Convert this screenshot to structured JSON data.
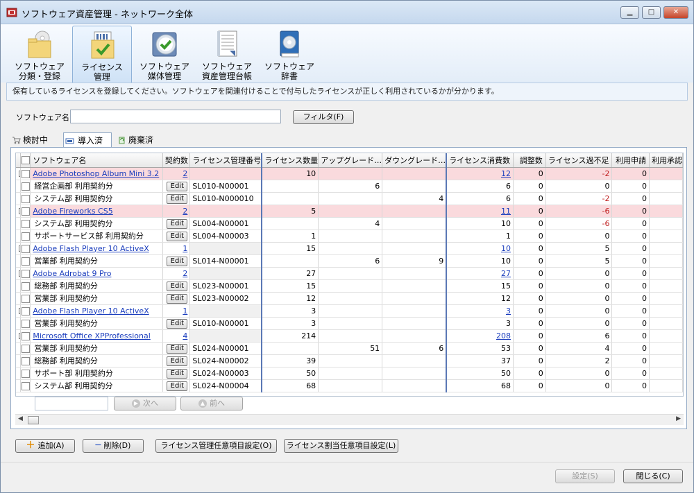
{
  "window": {
    "title": "ソフトウェア資産管理 - ネットワーク全体",
    "controls": {
      "minimize": "▁",
      "maximize": "□",
      "close": "✕"
    }
  },
  "ribbon": [
    {
      "line1": "ソフトウェア",
      "line2": "分類・登録",
      "icon": "folder-disc-icon"
    },
    {
      "line1": "ライセンス",
      "line2": "管理",
      "icon": "license-check-icon"
    },
    {
      "line1": "ソフトウェア",
      "line2": "媒体管理",
      "icon": "media-check-icon"
    },
    {
      "line1": "ソフトウェア",
      "line2": "資産管理台帳",
      "icon": "ledger-icon"
    },
    {
      "line1": "ソフトウェア",
      "line2": "辞書",
      "icon": "dictionary-icon"
    }
  ],
  "info_text": "保有しているライセンスを登録してください。ソフトウェアを関連付けることで付与したライセンスが正しく利用されているかが分かります。",
  "filter": {
    "label": "ソフトウェア名",
    "value": "",
    "button": "フィルタ(F)"
  },
  "tabs": [
    "検討中",
    "導入済",
    "廃棄済"
  ],
  "columns": [
    "ソフトウェア名",
    "契約数",
    "ライセンス管理番号",
    "ライセンス数量",
    "アップグレード…",
    "ダウングレード…",
    "ライセンス消費数",
    "調整数",
    "ライセンス過不足",
    "利用申請",
    "利用承認"
  ],
  "rows": [
    {
      "level": 0,
      "name": "Adobe  Photoshop Album Mini 3.2",
      "contracts": "2",
      "license_no": "",
      "qty": "10",
      "up": "",
      "down": "",
      "consumed": "12",
      "adjust": "0",
      "diff": "-2",
      "req": "0",
      "pink": true
    },
    {
      "level": 1,
      "name": "経営企画部  利用契約分",
      "contracts": "Edit",
      "license_no": "SL010-N00001",
      "qty": "",
      "up": "6",
      "down": "",
      "consumed": "6",
      "adjust": "0",
      "diff": "0",
      "req": "0",
      "pink": false
    },
    {
      "level": 1,
      "name": "システム部  利用契約分",
      "contracts": "Edit",
      "license_no": "SL010-N000010",
      "qty": "",
      "up": "",
      "down": "4",
      "consumed": "6",
      "adjust": "0",
      "diff": "-2",
      "req": "0",
      "pink": false
    },
    {
      "level": 0,
      "name": "Adobe Fireworks CS5",
      "contracts": "2",
      "license_no": "",
      "qty": "5",
      "up": "",
      "down": "",
      "consumed": "11",
      "adjust": "0",
      "diff": "-6",
      "req": "0",
      "pink": true
    },
    {
      "level": 1,
      "name": "システム部  利用契約分",
      "contracts": "Edit",
      "license_no": "SL004-N00001",
      "qty": "",
      "up": "4",
      "down": "",
      "consumed": "10",
      "adjust": "0",
      "diff": "-6",
      "req": "0",
      "pink": false
    },
    {
      "level": 1,
      "name": "サポートサービス部  利用契約分",
      "contracts": "Edit",
      "license_no": "SL004-N00003",
      "qty": "1",
      "up": "",
      "down": "",
      "consumed": "1",
      "adjust": "0",
      "diff": "0",
      "req": "0",
      "pink": false
    },
    {
      "level": 0,
      "name": "Adobe Flash Player 10 ActiveX",
      "contracts": "1",
      "license_no": "",
      "qty": "15",
      "up": "",
      "down": "",
      "consumed": "10",
      "adjust": "0",
      "diff": "5",
      "req": "0",
      "pink": false
    },
    {
      "level": 1,
      "name": "営業部  利用契約分",
      "contracts": "Edit",
      "license_no": "SL014-N00001",
      "qty": "",
      "up": "6",
      "down": "9",
      "consumed": "10",
      "adjust": "0",
      "diff": "5",
      "req": "0",
      "pink": false
    },
    {
      "level": 0,
      "name": "Adobe  Adrobat 9 Pro",
      "contracts": "2",
      "license_no": "",
      "qty": "27",
      "up": "",
      "down": "",
      "consumed": "27",
      "adjust": "0",
      "diff": "0",
      "req": "0",
      "pink": false
    },
    {
      "level": 1,
      "name": "総務部  利用契約分",
      "contracts": "Edit",
      "license_no": "SL023-N00001",
      "qty": "15",
      "up": "",
      "down": "",
      "consumed": "15",
      "adjust": "0",
      "diff": "0",
      "req": "0",
      "pink": false
    },
    {
      "level": 1,
      "name": "営業部  利用契約分",
      "contracts": "Edit",
      "license_no": "SL023-N00002",
      "qty": "12",
      "up": "",
      "down": "",
      "consumed": "12",
      "adjust": "0",
      "diff": "0",
      "req": "0",
      "pink": false
    },
    {
      "level": 0,
      "name": "Adobe Flash Player 10 ActiveX",
      "contracts": "1",
      "license_no": "",
      "qty": "3",
      "up": "",
      "down": "",
      "consumed": "3",
      "adjust": "0",
      "diff": "0",
      "req": "0",
      "pink": false
    },
    {
      "level": 1,
      "name": "営業部  利用契約分",
      "contracts": "Edit",
      "license_no": "SL010-N00001",
      "qty": "3",
      "up": "",
      "down": "",
      "consumed": "3",
      "adjust": "0",
      "diff": "0",
      "req": "0",
      "pink": false
    },
    {
      "level": 0,
      "name": "Microsoft Office XPProfessional",
      "contracts": "4",
      "license_no": "",
      "qty": "214",
      "up": "",
      "down": "",
      "consumed": "208",
      "adjust": "0",
      "diff": "6",
      "req": "0",
      "pink": false
    },
    {
      "level": 1,
      "name": "営業部  利用契約分",
      "contracts": "Edit",
      "license_no": "SL024-N00001",
      "qty": "",
      "up": "51",
      "down": "6",
      "consumed": "53",
      "adjust": "0",
      "diff": "4",
      "req": "0",
      "pink": false
    },
    {
      "level": 1,
      "name": "総務部  利用契約分",
      "contracts": "Edit",
      "license_no": "SL024-N00002",
      "qty": "39",
      "up": "",
      "down": "",
      "consumed": "37",
      "adjust": "0",
      "diff": "2",
      "req": "0",
      "pink": false
    },
    {
      "level": 1,
      "name": "サポート部  利用契約分",
      "contracts": "Edit",
      "license_no": "SL024-N00003",
      "qty": "50",
      "up": "",
      "down": "",
      "consumed": "50",
      "adjust": "0",
      "diff": "0",
      "req": "0",
      "pink": false
    },
    {
      "level": 1,
      "name": "システム部  利用契約分",
      "contracts": "Edit",
      "license_no": "SL024-N00004",
      "qty": "68",
      "up": "",
      "down": "",
      "consumed": "68",
      "adjust": "0",
      "diff": "0",
      "req": "0",
      "pink": false
    }
  ],
  "pager": {
    "next": "次へ",
    "prev": "前へ",
    "page_input": ""
  },
  "bottom_buttons": {
    "add": "追加(A)",
    "delete": "削除(D)",
    "license_mgmt_settings": "ライセンス管理任意項目設定(O)",
    "license_alloc_settings": "ライセンス割当任意項目設定(L)"
  },
  "footer": {
    "apply": "設定(S)",
    "close": "閉じる(C)"
  },
  "colors": {
    "pink_row": "#fadadd",
    "negative": "#c02020",
    "link": "#1a3dbd"
  }
}
